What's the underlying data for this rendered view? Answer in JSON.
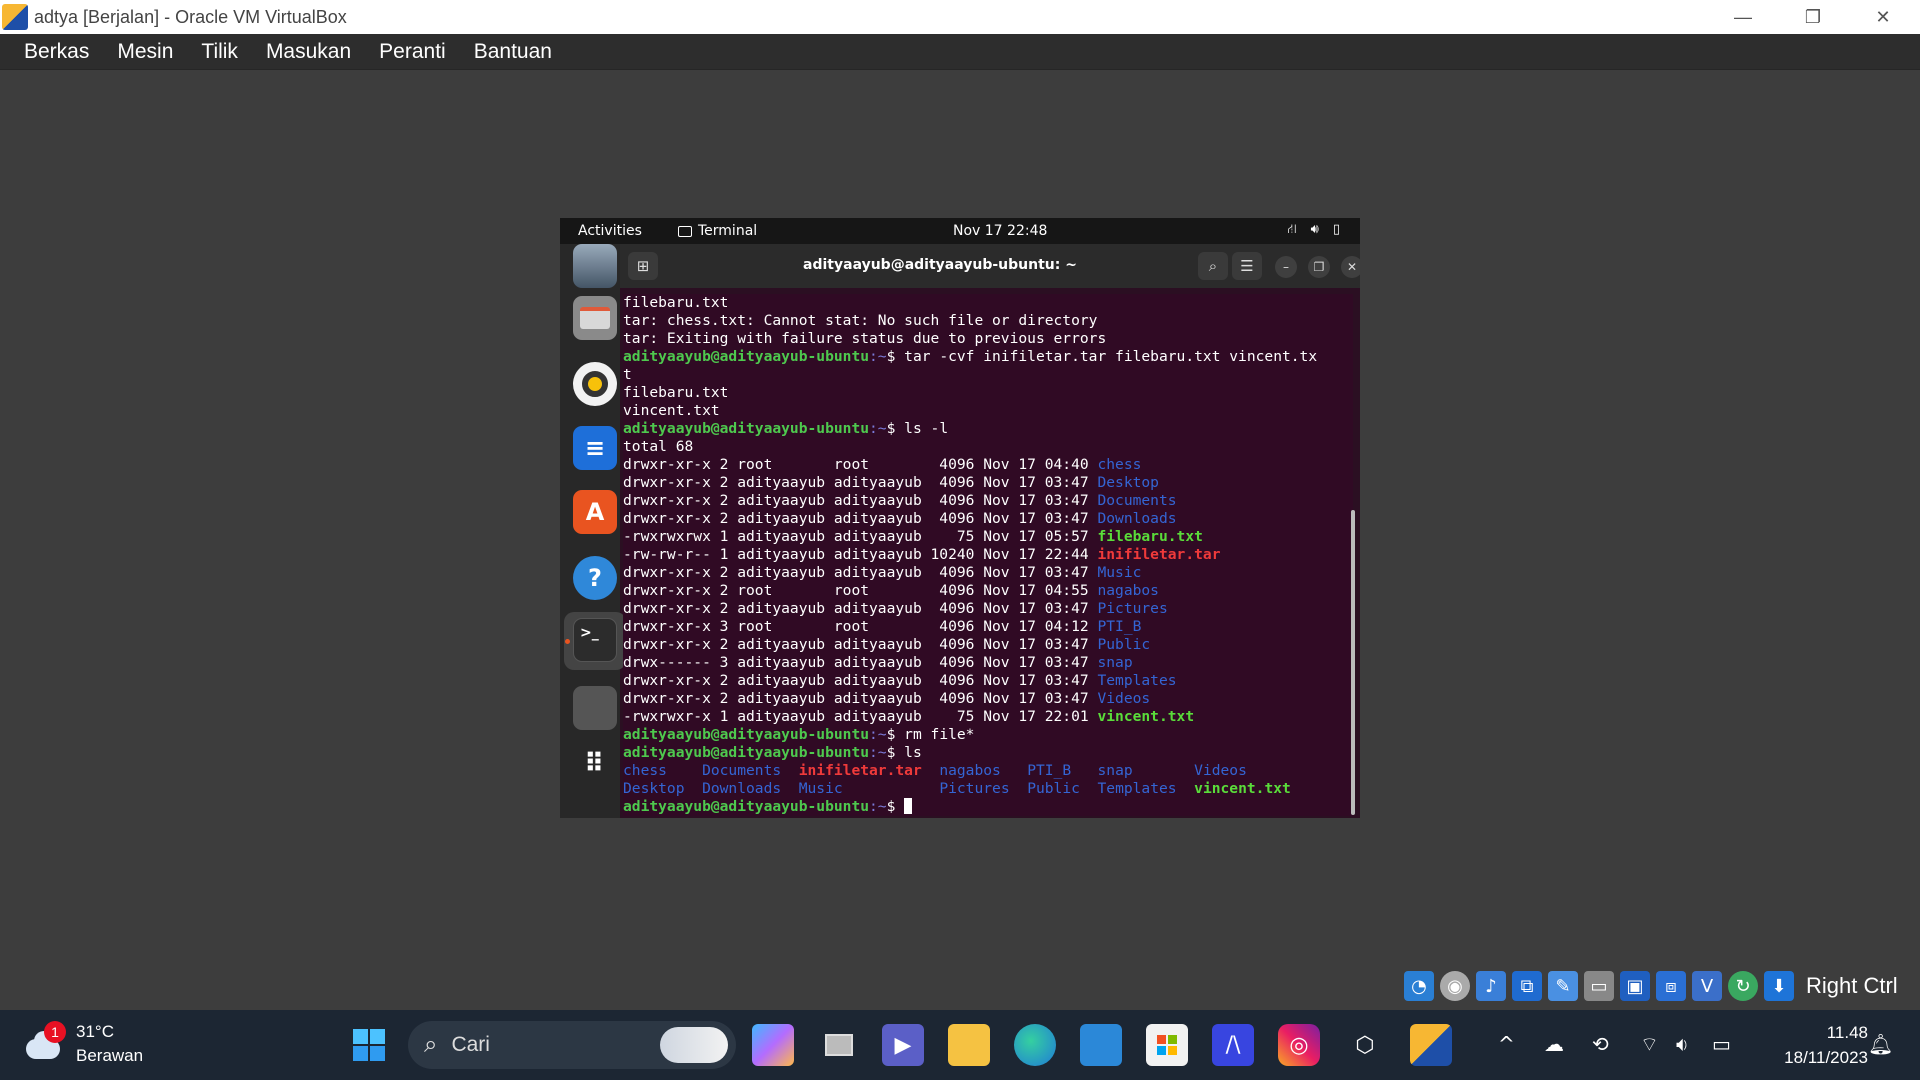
{
  "window": {
    "title": "adtya [Berjalan] - Oracle VM VirtualBox",
    "minimize_glyph": "—",
    "restore_glyph": "❐",
    "close_glyph": "✕"
  },
  "menu": [
    "Berkas",
    "Mesin",
    "Tilik",
    "Masukan",
    "Peranti",
    "Bantuan"
  ],
  "gnome": {
    "activities": "Activities",
    "app_name": "Terminal",
    "clock": "Nov 17  22:48"
  },
  "terminal": {
    "title": "adityaayub@adityaayub-ubuntu: ~",
    "prompt_user": "adityaayub@adityaayub-ubuntu",
    "prompt_path": ":~",
    "prompt_sign": "$ ",
    "lines": [
      {
        "t": "plain",
        "text": "filebaru.txt"
      },
      {
        "t": "plain",
        "text": "tar: chess.txt: Cannot stat: No such file or directory"
      },
      {
        "t": "plain",
        "text": "tar: Exiting with failure status due to previous errors"
      },
      {
        "t": "cmd",
        "text": "tar -cvf inifiletar.tar filebaru.txt vincent.tx"
      },
      {
        "t": "plain",
        "text": "t"
      },
      {
        "t": "plain",
        "text": "filebaru.txt"
      },
      {
        "t": "plain",
        "text": "vincent.txt"
      },
      {
        "t": "cmd",
        "text": "ls -l"
      },
      {
        "t": "plain",
        "text": "total 68"
      },
      {
        "t": "ls",
        "meta": "drwxr-xr-x 2 root       root        4096 Nov 17 04:40 ",
        "name": "chess",
        "c": "blue"
      },
      {
        "t": "ls",
        "meta": "drwxr-xr-x 2 adityaayub adityaayub  4096 Nov 17 03:47 ",
        "name": "Desktop",
        "c": "blue"
      },
      {
        "t": "ls",
        "meta": "drwxr-xr-x 2 adityaayub adityaayub  4096 Nov 17 03:47 ",
        "name": "Documents",
        "c": "blue"
      },
      {
        "t": "ls",
        "meta": "drwxr-xr-x 2 adityaayub adityaayub  4096 Nov 17 03:47 ",
        "name": "Downloads",
        "c": "blue"
      },
      {
        "t": "ls",
        "meta": "-rwxrwxrwx 1 adityaayub adityaayub    75 Nov 17 05:57 ",
        "name": "filebaru.txt",
        "c": "green"
      },
      {
        "t": "ls",
        "meta": "-rw-rw-r-- 1 adityaayub adityaayub 10240 Nov 17 22:44 ",
        "name": "inifiletar.tar",
        "c": "red"
      },
      {
        "t": "ls",
        "meta": "drwxr-xr-x 2 adityaayub adityaayub  4096 Nov 17 03:47 ",
        "name": "Music",
        "c": "blue"
      },
      {
        "t": "ls",
        "meta": "drwxr-xr-x 2 root       root        4096 Nov 17 04:55 ",
        "name": "nagabos",
        "c": "blue"
      },
      {
        "t": "ls",
        "meta": "drwxr-xr-x 2 adityaayub adityaayub  4096 Nov 17 03:47 ",
        "name": "Pictures",
        "c": "blue"
      },
      {
        "t": "ls",
        "meta": "drwxr-xr-x 3 root       root        4096 Nov 17 04:12 ",
        "name": "PTI_B",
        "c": "blue"
      },
      {
        "t": "ls",
        "meta": "drwxr-xr-x 2 adityaayub adityaayub  4096 Nov 17 03:47 ",
        "name": "Public",
        "c": "blue"
      },
      {
        "t": "ls",
        "meta": "drwx------ 3 adityaayub adityaayub  4096 Nov 17 03:47 ",
        "name": "snap",
        "c": "blue"
      },
      {
        "t": "ls",
        "meta": "drwxr-xr-x 2 adityaayub adityaayub  4096 Nov 17 03:47 ",
        "name": "Templates",
        "c": "blue"
      },
      {
        "t": "ls",
        "meta": "drwxr-xr-x 2 adityaayub adityaayub  4096 Nov 17 03:47 ",
        "name": "Videos",
        "c": "blue"
      },
      {
        "t": "ls",
        "meta": "-rwxrwxr-x 1 adityaayub adityaayub    75 Nov 17 22:01 ",
        "name": "vincent.txt",
        "c": "green"
      },
      {
        "t": "cmd",
        "text": "rm file*"
      },
      {
        "t": "cmd",
        "text": "ls"
      },
      {
        "t": "grid",
        "cells": [
          {
            "text": "chess    ",
            "c": "blue"
          },
          {
            "text": "Documents  ",
            "c": "blue"
          },
          {
            "text": "inifiletar.tar  ",
            "c": "red"
          },
          {
            "text": "nagabos   ",
            "c": "blue"
          },
          {
            "text": "PTI_B   ",
            "c": "blue"
          },
          {
            "text": "snap       ",
            "c": "blue"
          },
          {
            "text": "Videos",
            "c": "blue"
          }
        ]
      },
      {
        "t": "grid",
        "cells": [
          {
            "text": "Desktop  ",
            "c": "blue"
          },
          {
            "text": "Downloads  ",
            "c": "blue"
          },
          {
            "text": "Music           ",
            "c": "blue"
          },
          {
            "text": "Pictures  ",
            "c": "blue"
          },
          {
            "text": "Public  ",
            "c": "blue"
          },
          {
            "text": "Templates  ",
            "c": "blue"
          },
          {
            "text": "vincent.txt",
            "c": "green"
          }
        ]
      },
      {
        "t": "prompt"
      }
    ]
  },
  "vbox_status": {
    "host_key": "Right Ctrl"
  },
  "taskbar": {
    "weather_temp": "31°C",
    "weather_desc": "Berawan",
    "weather_badge": "1",
    "search_placeholder": "Cari",
    "time": "11.48",
    "date": "18/11/2023"
  },
  "colors": {
    "terminal_bg": "#300a24",
    "prompt_green": "#4ec94e",
    "dir_blue": "#3465d4",
    "exec_green": "#5adc3a",
    "archive_red": "#ef3a3a",
    "taskbar_bg": "#1c2633"
  }
}
